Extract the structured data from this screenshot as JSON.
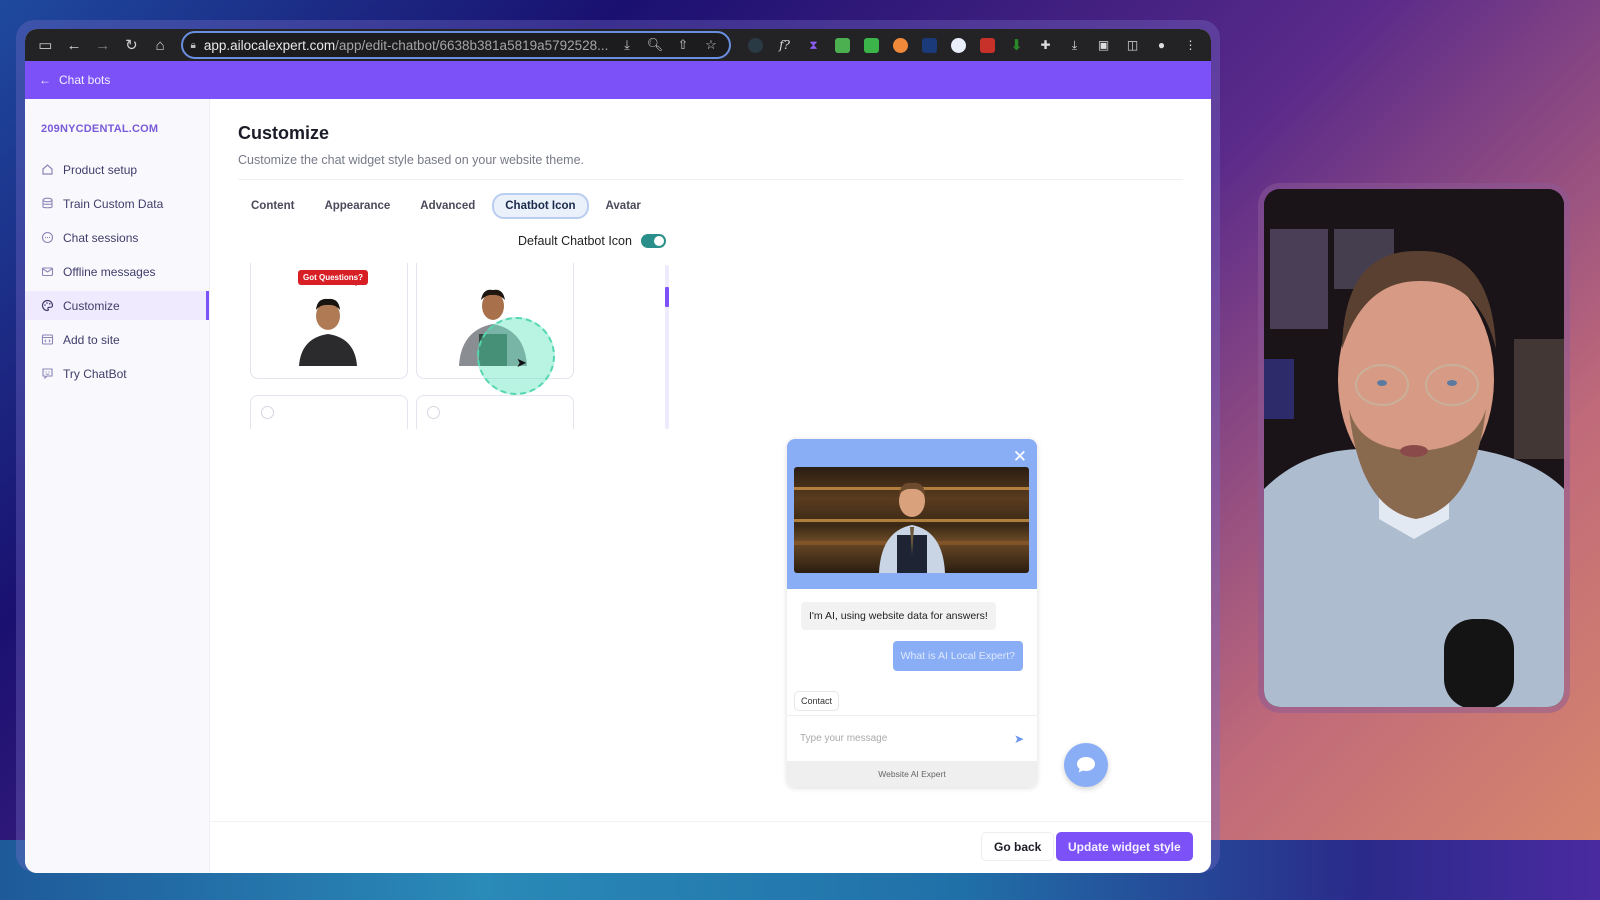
{
  "browser": {
    "url_host": "app.ailocalexpert.com",
    "url_path": "/app/edit-chatbot/6638b381a5819a5792528...",
    "nav_icons": [
      "sidebar-toggle-icon",
      "back-icon",
      "forward-icon",
      "reload-icon",
      "home-icon"
    ],
    "omnibox_icons": [
      "install-app-icon",
      "zoom-icon",
      "share-icon",
      "bookmark-star-icon"
    ],
    "extension_icons": [
      "cursor-ext-icon",
      "formula-ext-icon",
      "hourglass-ext-icon",
      "robot-ext-icon",
      "v-ext-icon",
      "m-ext-icon",
      "card-ext-icon",
      "sparkle-ext-icon",
      "screen-ext-icon",
      "arrow-down-ext-icon",
      "extensions-puzzle-icon",
      "downloads-icon",
      "reading-list-icon",
      "split-view-icon",
      "profile-icon",
      "menu-icon"
    ]
  },
  "topbar": {
    "back_label": "Chat bots"
  },
  "sidebar": {
    "brand": "209NYCDENTAL.COM",
    "items": [
      {
        "label": "Product setup",
        "icon": "home-icon"
      },
      {
        "label": "Train Custom Data",
        "icon": "database-icon"
      },
      {
        "label": "Chat sessions",
        "icon": "chat-bubble-icon"
      },
      {
        "label": "Offline messages",
        "icon": "mail-icon"
      },
      {
        "label": "Customize",
        "icon": "palette-icon",
        "active": true
      },
      {
        "label": "Add to site",
        "icon": "code-window-icon"
      },
      {
        "label": "Try ChatBot",
        "icon": "bot-face-icon"
      }
    ]
  },
  "main": {
    "title": "Customize",
    "subtitle": "Customize the chat widget style based on your website theme.",
    "tabs": [
      {
        "label": "Content"
      },
      {
        "label": "Appearance"
      },
      {
        "label": "Advanced"
      },
      {
        "label": "Chatbot Icon",
        "active": true
      },
      {
        "label": "Avatar"
      }
    ],
    "default_icon_toggle": {
      "label": "Default Chatbot Icon",
      "on": true
    },
    "icon_options": [
      {
        "caption": "Got Questions?",
        "selected": false
      },
      {
        "caption": "",
        "selected": false
      },
      {
        "caption": "",
        "selected": false
      },
      {
        "caption": "",
        "selected": false
      }
    ]
  },
  "widget_preview": {
    "bot_message": "I'm AI, using website data for answers!",
    "user_message": "What is AI Local Expert?",
    "quick_reply": "Contact",
    "input_placeholder": "Type your message",
    "footer": "Website AI Expert",
    "header_color": "#8aaef6"
  },
  "actions": {
    "go_back": "Go back",
    "update": "Update widget style"
  },
  "colors": {
    "accent": "#7c52f8",
    "toggle_on": "#2a8f8a",
    "widget": "#8aaef6"
  }
}
